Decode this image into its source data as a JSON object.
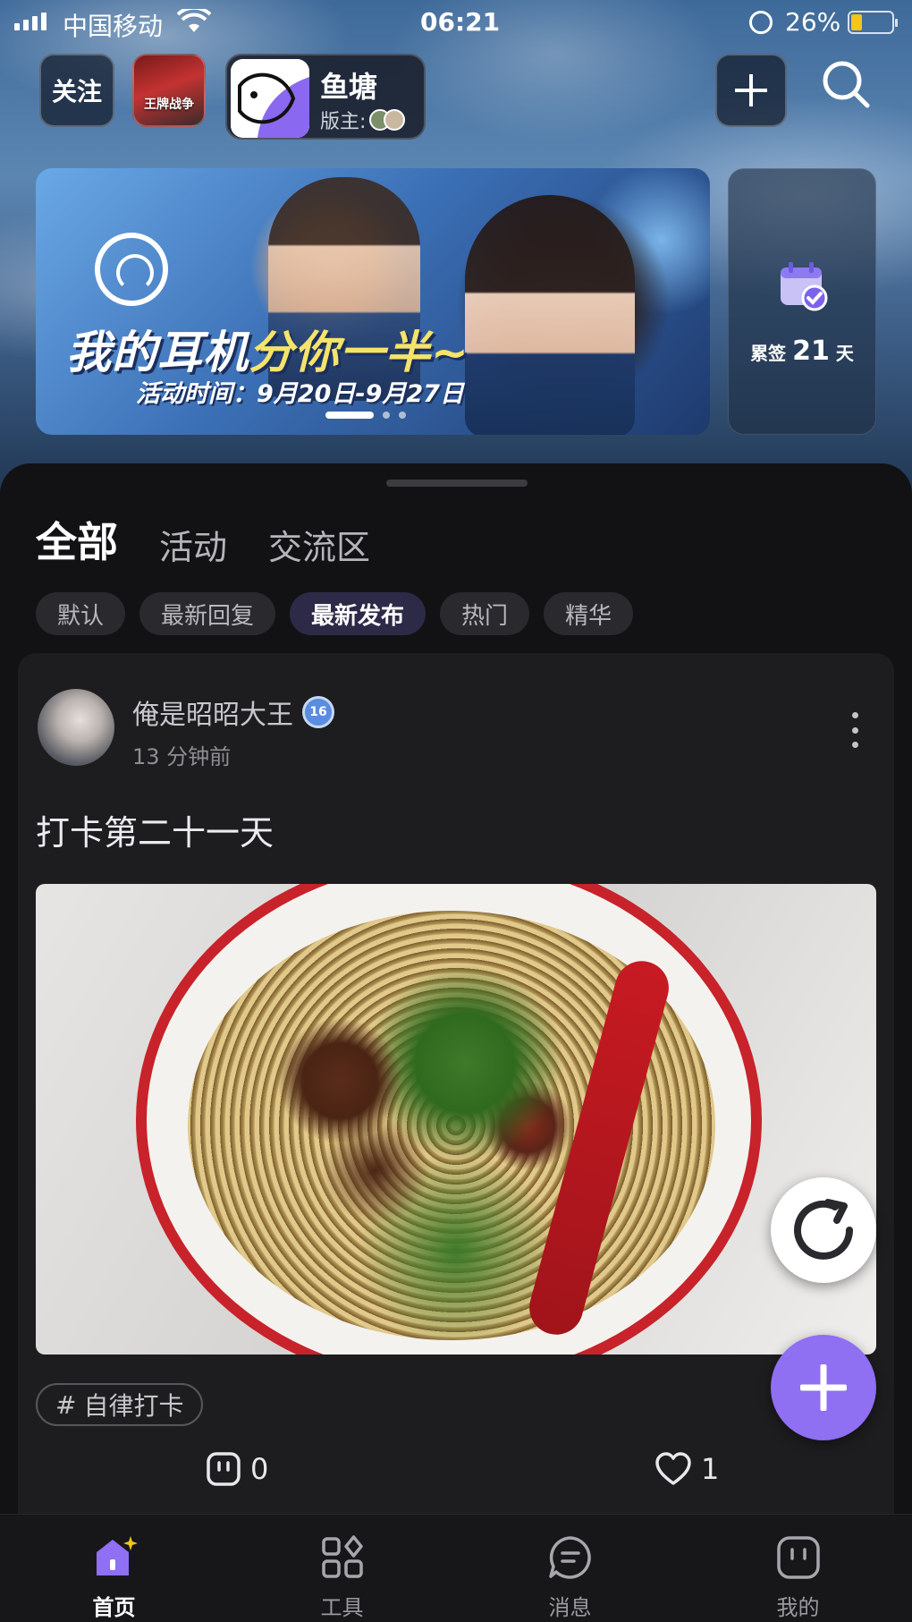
{
  "status_bar": {
    "carrier": "中国移动",
    "time": "06:21",
    "battery_percent": "26%"
  },
  "header": {
    "follow_label": "关注",
    "game_thumb_text": "王牌战争",
    "pond": {
      "name": "鱼塘",
      "moderator_label": "版主:"
    }
  },
  "banner": {
    "title_part1": "我的耳机",
    "title_part2": "分你一半~",
    "date": "活动时间：9月20日-9月27日",
    "active_slide": 0,
    "slide_count": 3
  },
  "checkin": {
    "prefix": "累签",
    "days": "21",
    "suffix": "天"
  },
  "tabs": [
    {
      "label": "全部",
      "active": true
    },
    {
      "label": "活动",
      "active": false
    },
    {
      "label": "交流区",
      "active": false
    }
  ],
  "filters": [
    {
      "label": "默认",
      "active": false
    },
    {
      "label": "最新回复",
      "active": false
    },
    {
      "label": "最新发布",
      "active": true
    },
    {
      "label": "热门",
      "active": false
    },
    {
      "label": "精华",
      "active": false
    }
  ],
  "post": {
    "author": "俺是昭昭大王",
    "level": "16",
    "time": "13 分钟前",
    "text": "打卡第二十一天",
    "tag": "自律打卡",
    "comment_count": "0",
    "like_count": "1"
  },
  "bottom_nav": [
    {
      "label": "首页",
      "icon": "home-icon",
      "active": true
    },
    {
      "label": "工具",
      "icon": "tools-icon",
      "active": false
    },
    {
      "label": "消息",
      "icon": "message-icon",
      "active": false
    },
    {
      "label": "我的",
      "icon": "profile-icon",
      "active": false
    }
  ],
  "colors": {
    "accent": "#8f6ff2",
    "tab_highlight": "#7b5cf0",
    "background": "#121214",
    "card": "#1d1d20"
  }
}
